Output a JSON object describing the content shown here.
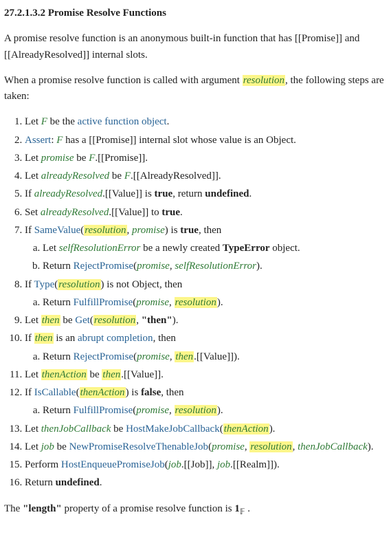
{
  "title": "27.2.1.3.2  Promise Resolve Functions",
  "intro1_parts": [
    {
      "t": "text",
      "v": "A promise resolve function is an anonymous built-in function that has [[Promise]] and [[AlreadyResolved]] internal slots."
    }
  ],
  "intro2_parts": [
    {
      "t": "text",
      "v": "When a promise resolve function is called with argument "
    },
    {
      "t": "var-hl",
      "v": "resolution"
    },
    {
      "t": "text",
      "v": ", the following steps are taken:"
    }
  ],
  "steps": [
    {
      "parts": [
        {
          "t": "text",
          "v": "Let "
        },
        {
          "t": "var-it",
          "v": "F"
        },
        {
          "t": "text",
          "v": " be the "
        },
        {
          "t": "link",
          "v": "active function object"
        },
        {
          "t": "text",
          "v": "."
        }
      ]
    },
    {
      "parts": [
        {
          "t": "link",
          "v": "Assert"
        },
        {
          "t": "text",
          "v": ": "
        },
        {
          "t": "var-it",
          "v": "F"
        },
        {
          "t": "text",
          "v": " has a [[Promise]] internal slot whose value is an Object."
        }
      ]
    },
    {
      "parts": [
        {
          "t": "text",
          "v": "Let "
        },
        {
          "t": "var-it",
          "v": "promise"
        },
        {
          "t": "text",
          "v": " be "
        },
        {
          "t": "var-it",
          "v": "F"
        },
        {
          "t": "text",
          "v": ".[[Promise]]."
        }
      ]
    },
    {
      "parts": [
        {
          "t": "text",
          "v": "Let "
        },
        {
          "t": "var-it",
          "v": "alreadyResolved"
        },
        {
          "t": "text",
          "v": " be "
        },
        {
          "t": "var-it",
          "v": "F"
        },
        {
          "t": "text",
          "v": ".[[AlreadyResolved]]."
        }
      ]
    },
    {
      "parts": [
        {
          "t": "text",
          "v": "If "
        },
        {
          "t": "var-it",
          "v": "alreadyResolved"
        },
        {
          "t": "text",
          "v": ".[[Value]] is "
        },
        {
          "t": "bold",
          "v": "true"
        },
        {
          "t": "text",
          "v": ", return "
        },
        {
          "t": "bold",
          "v": "undefined"
        },
        {
          "t": "text",
          "v": "."
        }
      ]
    },
    {
      "parts": [
        {
          "t": "text",
          "v": "Set "
        },
        {
          "t": "var-it",
          "v": "alreadyResolved"
        },
        {
          "t": "text",
          "v": ".[[Value]] to "
        },
        {
          "t": "bold",
          "v": "true"
        },
        {
          "t": "text",
          "v": "."
        }
      ]
    },
    {
      "parts": [
        {
          "t": "text",
          "v": "If "
        },
        {
          "t": "link",
          "v": "SameValue"
        },
        {
          "t": "text",
          "v": "("
        },
        {
          "t": "var-hl",
          "v": "resolution"
        },
        {
          "t": "text",
          "v": ", "
        },
        {
          "t": "var-it",
          "v": "promise"
        },
        {
          "t": "text",
          "v": ") is "
        },
        {
          "t": "bold",
          "v": "true"
        },
        {
          "t": "text",
          "v": ", then"
        }
      ],
      "sub": [
        {
          "parts": [
            {
              "t": "text",
              "v": "Let "
            },
            {
              "t": "var-it",
              "v": "selfResolutionError"
            },
            {
              "t": "text",
              "v": " be a newly created "
            },
            {
              "t": "bold",
              "v": "TypeError"
            },
            {
              "t": "text",
              "v": " object."
            }
          ]
        },
        {
          "parts": [
            {
              "t": "text",
              "v": "Return "
            },
            {
              "t": "link",
              "v": "RejectPromise"
            },
            {
              "t": "text",
              "v": "("
            },
            {
              "t": "var-it",
              "v": "promise"
            },
            {
              "t": "text",
              "v": ", "
            },
            {
              "t": "var-it",
              "v": "selfResolutionError"
            },
            {
              "t": "text",
              "v": ")."
            }
          ]
        }
      ]
    },
    {
      "parts": [
        {
          "t": "text",
          "v": "If "
        },
        {
          "t": "link",
          "v": "Type"
        },
        {
          "t": "text",
          "v": "("
        },
        {
          "t": "var-hl",
          "v": "resolution"
        },
        {
          "t": "text",
          "v": ") is not Object, then"
        }
      ],
      "sub": [
        {
          "parts": [
            {
              "t": "text",
              "v": "Return "
            },
            {
              "t": "link",
              "v": "FulfillPromise"
            },
            {
              "t": "text",
              "v": "("
            },
            {
              "t": "var-it",
              "v": "promise"
            },
            {
              "t": "text",
              "v": ", "
            },
            {
              "t": "var-hl",
              "v": "resolution"
            },
            {
              "t": "text",
              "v": ")."
            }
          ]
        }
      ]
    },
    {
      "parts": [
        {
          "t": "text",
          "v": "Let "
        },
        {
          "t": "var-hl",
          "v": "then"
        },
        {
          "t": "text",
          "v": " be "
        },
        {
          "t": "link",
          "v": "Get"
        },
        {
          "t": "text",
          "v": "("
        },
        {
          "t": "var-hl",
          "v": "resolution"
        },
        {
          "t": "text",
          "v": ", "
        },
        {
          "t": "bold",
          "v": "\"then\""
        },
        {
          "t": "text",
          "v": ")."
        }
      ]
    },
    {
      "parts": [
        {
          "t": "text",
          "v": "If "
        },
        {
          "t": "var-hl",
          "v": "then"
        },
        {
          "t": "text",
          "v": " is an "
        },
        {
          "t": "link",
          "v": "abrupt completion"
        },
        {
          "t": "text",
          "v": ", then"
        }
      ],
      "sub": [
        {
          "parts": [
            {
              "t": "text",
              "v": "Return "
            },
            {
              "t": "link",
              "v": "RejectPromise"
            },
            {
              "t": "text",
              "v": "("
            },
            {
              "t": "var-it",
              "v": "promise"
            },
            {
              "t": "text",
              "v": ", "
            },
            {
              "t": "var-hl",
              "v": "then"
            },
            {
              "t": "text",
              "v": ".[[Value]])."
            }
          ]
        }
      ]
    },
    {
      "parts": [
        {
          "t": "text",
          "v": "Let "
        },
        {
          "t": "var-hl",
          "v": "thenAction"
        },
        {
          "t": "text",
          "v": " be "
        },
        {
          "t": "var-hl",
          "v": "then"
        },
        {
          "t": "text",
          "v": ".[[Value]]."
        }
      ]
    },
    {
      "parts": [
        {
          "t": "text",
          "v": "If "
        },
        {
          "t": "link",
          "v": "IsCallable"
        },
        {
          "t": "text",
          "v": "("
        },
        {
          "t": "var-hl",
          "v": "thenAction"
        },
        {
          "t": "text",
          "v": ") is "
        },
        {
          "t": "bold",
          "v": "false"
        },
        {
          "t": "text",
          "v": ", then"
        }
      ],
      "sub": [
        {
          "parts": [
            {
              "t": "text",
              "v": "Return "
            },
            {
              "t": "link",
              "v": "FulfillPromise"
            },
            {
              "t": "text",
              "v": "("
            },
            {
              "t": "var-it",
              "v": "promise"
            },
            {
              "t": "text",
              "v": ", "
            },
            {
              "t": "var-hl",
              "v": "resolution"
            },
            {
              "t": "text",
              "v": ")."
            }
          ]
        }
      ]
    },
    {
      "parts": [
        {
          "t": "text",
          "v": "Let "
        },
        {
          "t": "var-it",
          "v": "thenJobCallback"
        },
        {
          "t": "text",
          "v": " be "
        },
        {
          "t": "link",
          "v": "HostMakeJobCallback"
        },
        {
          "t": "text",
          "v": "("
        },
        {
          "t": "var-hl",
          "v": "thenAction"
        },
        {
          "t": "text",
          "v": ")."
        }
      ]
    },
    {
      "parts": [
        {
          "t": "text",
          "v": "Let "
        },
        {
          "t": "var-it",
          "v": "job"
        },
        {
          "t": "text",
          "v": " be "
        },
        {
          "t": "link",
          "v": "NewPromiseResolveThenableJob"
        },
        {
          "t": "text",
          "v": "("
        },
        {
          "t": "var-it",
          "v": "promise"
        },
        {
          "t": "text",
          "v": ", "
        },
        {
          "t": "var-hl",
          "v": "resolution"
        },
        {
          "t": "text",
          "v": ", "
        },
        {
          "t": "var-it",
          "v": "thenJobCallback"
        },
        {
          "t": "text",
          "v": ")."
        }
      ]
    },
    {
      "parts": [
        {
          "t": "text",
          "v": "Perform "
        },
        {
          "t": "link",
          "v": "HostEnqueuePromiseJob"
        },
        {
          "t": "text",
          "v": "("
        },
        {
          "t": "var-it",
          "v": "job"
        },
        {
          "t": "text",
          "v": ".[[Job]], "
        },
        {
          "t": "var-it",
          "v": "job"
        },
        {
          "t": "text",
          "v": ".[[Realm]])."
        }
      ]
    },
    {
      "parts": [
        {
          "t": "text",
          "v": "Return "
        },
        {
          "t": "bold",
          "v": "undefined"
        },
        {
          "t": "text",
          "v": "."
        }
      ]
    }
  ],
  "outro_parts": [
    {
      "t": "text",
      "v": "The "
    },
    {
      "t": "bold",
      "v": "\"length\""
    },
    {
      "t": "text",
      "v": " property of a promise resolve function is "
    },
    {
      "t": "bold",
      "v": "1"
    },
    {
      "t": "subf",
      "v": "𝔽"
    },
    {
      "t": "text",
      "v": " ."
    }
  ]
}
